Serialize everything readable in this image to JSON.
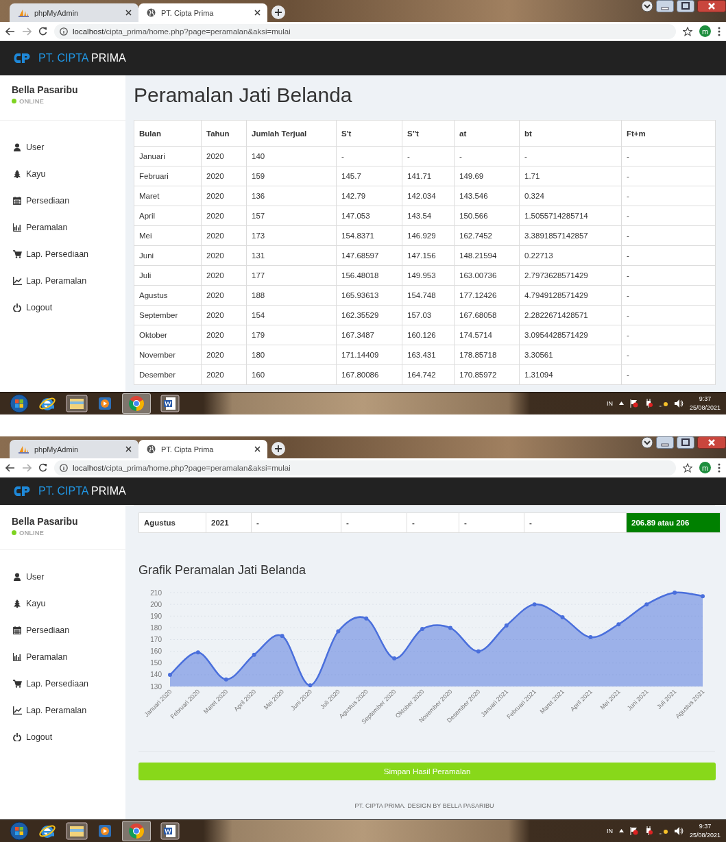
{
  "screens": [
    {
      "browser": {
        "tabs": [
          {
            "title": "phpMyAdmin",
            "selected": false
          },
          {
            "title": "PT. Cipta Prima",
            "selected": true
          }
        ],
        "url_host": "localhost",
        "url_path": "/cipta_prima/home.php?page=peramalan&aksi=mulai",
        "profile_letter": "m"
      },
      "brand": {
        "accent": "PT. CIPTA",
        "rest": "PRIMA"
      },
      "sidebar": {
        "user_name": "Bella Pasaribu",
        "status": "ONLINE",
        "items": [
          "User",
          "Kayu",
          "Persediaan",
          "Peramalan",
          "Lap. Persediaan",
          "Lap. Peramalan",
          "Logout"
        ]
      },
      "content": {
        "kind": "table-page",
        "title": "Peramalan Jati Belanda",
        "table": {
          "columns": [
            "Bulan",
            "Tahun",
            "Jumlah Terjual",
            "S't",
            "S\"t",
            "at",
            "bt",
            "Ft+m"
          ],
          "rows": [
            {
              "kind": "data",
              "cells": [
                "Januari",
                "2020",
                "140",
                "-",
                "-",
                "-",
                "-",
                "-"
              ]
            },
            {
              "kind": "data",
              "cells": [
                "Februari",
                "2020",
                "159",
                "145.7",
                "141.71",
                "149.69",
                "1.71",
                "-"
              ]
            },
            {
              "kind": "data",
              "cells": [
                "Maret",
                "2020",
                "136",
                "142.79",
                "142.034",
                "143.546",
                "0.324",
                "-"
              ]
            },
            {
              "kind": "data",
              "cells": [
                "April",
                "2020",
                "157",
                "147.053",
                "143.54",
                "150.566",
                "1.5055714285714",
                "-"
              ]
            },
            {
              "kind": "data",
              "cells": [
                "Mei",
                "2020",
                "173",
                "154.8371",
                "146.929",
                "162.7452",
                "3.3891857142857",
                "-"
              ]
            },
            {
              "kind": "data",
              "cells": [
                "Juni",
                "2020",
                "131",
                "147.68597",
                "147.156",
                "148.21594",
                "0.22713",
                "-"
              ]
            },
            {
              "kind": "data",
              "cells": [
                "Juli",
                "2020",
                "177",
                "156.48018",
                "149.953",
                "163.00736",
                "2.7973628571429",
                "-"
              ]
            },
            {
              "kind": "data",
              "cells": [
                "Agustus",
                "2020",
                "188",
                "165.93613",
                "154.748",
                "177.12426",
                "4.7949128571429",
                "-"
              ]
            },
            {
              "kind": "data",
              "cells": [
                "September",
                "2020",
                "154",
                "162.35529",
                "157.03",
                "167.68058",
                "2.2822671428571",
                "-"
              ]
            },
            {
              "kind": "data",
              "cells": [
                "Oktober",
                "2020",
                "179",
                "167.3487",
                "160.126",
                "174.5714",
                "3.0954428571429",
                "-"
              ]
            },
            {
              "kind": "data",
              "cells": [
                "November",
                "2020",
                "180",
                "171.14409",
                "163.431",
                "178.85718",
                "3.30561",
                "-"
              ]
            },
            {
              "kind": "data",
              "cells": [
                "Desember",
                "2020",
                "160",
                "167.80086",
                "164.742",
                "170.85972",
                "1.31094",
                "-"
              ]
            }
          ]
        }
      },
      "taskbar": {
        "language": "IN",
        "time": "9:37",
        "date": "25/08/2021"
      }
    },
    {
      "browser": {
        "tabs": [
          {
            "title": "phpMyAdmin",
            "selected": false
          },
          {
            "title": "PT. Cipta Prima",
            "selected": true
          }
        ],
        "url_host": "localhost",
        "url_path": "/cipta_prima/home.php?page=peramalan&aksi=mulai",
        "profile_letter": "m"
      },
      "brand": {
        "accent": "PT. CIPTA",
        "rest": "PRIMA"
      },
      "sidebar": {
        "user_name": "Bella Pasaribu",
        "status": "ONLINE",
        "items": [
          "User",
          "Kayu",
          "Persediaan",
          "Peramalan",
          "Lap. Persediaan",
          "Lap. Peramalan",
          "Logout"
        ]
      },
      "content": {
        "kind": "chart-page",
        "table": {
          "rows": [
            {
              "kind": "result",
              "cells": [
                "Agustus",
                "2021",
                "-",
                "-",
                "-",
                "-",
                "-",
                "206.89 atau 206"
              ]
            }
          ]
        },
        "chart_title": "Grafik Peramalan Jati Belanda",
        "chart_data": {
          "type": "area",
          "categories": [
            "Januari 2020",
            "Februari 2020",
            "Maret 2020",
            "April 2020",
            "Mei 2020",
            "Juni 2020",
            "Juli 2020",
            "Agustus 2020",
            "September 2020",
            "Oktober 2020",
            "November 2020",
            "Desember 2020",
            "Januari 2021",
            "Februari 2021",
            "Maret 2021",
            "April 2021",
            "Mei 2021",
            "Juni 2021",
            "Juli 2021",
            "Agustus 2021"
          ],
          "series": [
            {
              "color": "#4a6fdc",
              "values": [
                140,
                159,
                136,
                157,
                173,
                131,
                177,
                188,
                154,
                179,
                180,
                160,
                182,
                200,
                189,
                172,
                183,
                200,
                210,
                207
              ]
            }
          ],
          "ylim": [
            130,
            210
          ],
          "grid": true,
          "yticks": [
            130,
            140,
            150,
            160,
            170,
            180,
            190,
            200,
            210
          ]
        },
        "button": "Simpan Hasil Peramalan",
        "footer": "PT. CIPTA PRIMA. DESIGN BY BELLA PASARIBU"
      },
      "taskbar": {
        "language": "IN",
        "time": "9:37",
        "date": "25/08/2021"
      }
    }
  ]
}
